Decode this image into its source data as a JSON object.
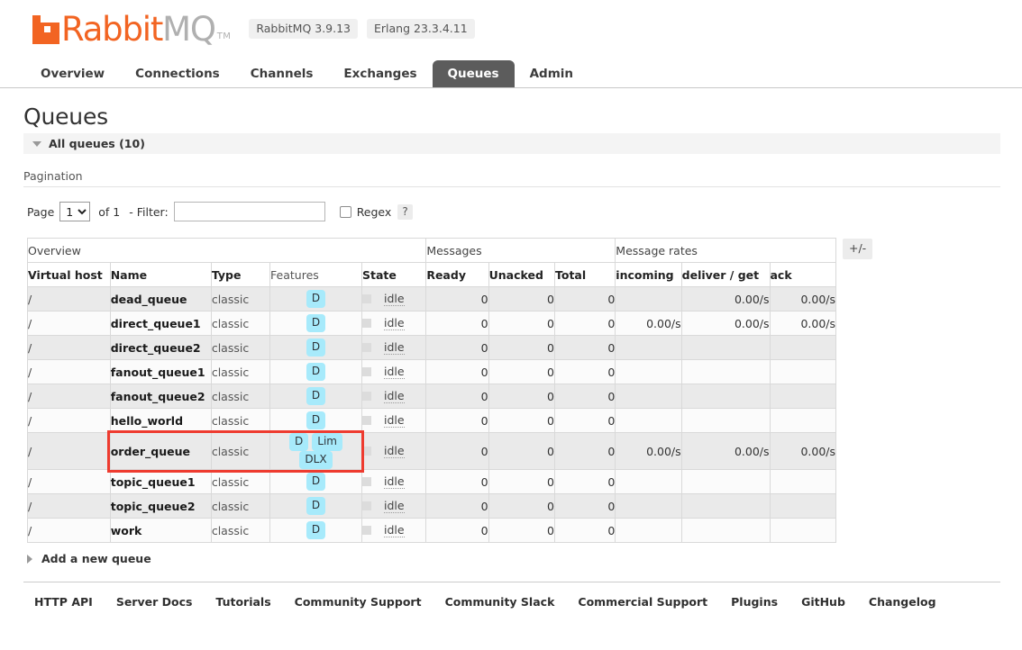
{
  "brand": {
    "name_primary": "Rabbit",
    "name_secondary": "MQ",
    "trademark": "TM",
    "logo_color": "#f26422",
    "versions": [
      {
        "label": "RabbitMQ 3.9.13"
      },
      {
        "label": "Erlang 23.3.4.11"
      }
    ]
  },
  "nav": {
    "tabs": [
      {
        "label": "Overview",
        "active": false
      },
      {
        "label": "Connections",
        "active": false
      },
      {
        "label": "Channels",
        "active": false
      },
      {
        "label": "Exchanges",
        "active": false
      },
      {
        "label": "Queues",
        "active": true
      },
      {
        "label": "Admin",
        "active": false
      }
    ],
    "active_color": "#5c5c5c"
  },
  "page": {
    "title": "Queues",
    "section_header": "All queues (10)"
  },
  "pagination": {
    "label": "Pagination",
    "page_label": "Page",
    "page_value": "1",
    "page_options": [
      "1"
    ],
    "of_label": "of 1",
    "filter_prefix": "- Filter:",
    "filter_value": "",
    "filter_placeholder": "",
    "regex_label": "Regex",
    "regex_checked": false,
    "help_label": "?"
  },
  "table": {
    "group_headers": [
      {
        "label": "Overview",
        "span": 5
      },
      {
        "label": "Messages",
        "span": 3
      },
      {
        "label": "Message rates",
        "span": 3
      }
    ],
    "columns": [
      {
        "label": "Virtual host",
        "sortable": true
      },
      {
        "label": "Name",
        "sortable": true
      },
      {
        "label": "Type",
        "sortable": true
      },
      {
        "label": "Features",
        "sortable": false
      },
      {
        "label": "State",
        "sortable": true
      },
      {
        "label": "Ready",
        "sortable": true
      },
      {
        "label": "Unacked",
        "sortable": true
      },
      {
        "label": "Total",
        "sortable": true
      },
      {
        "label": "incoming",
        "sortable": true
      },
      {
        "label": "deliver / get",
        "sortable": true
      },
      {
        "label": "ack",
        "sortable": true
      }
    ],
    "toggle_columns_label": "+/-",
    "feature_badge_color": "#a7eafb",
    "highlight_color": "#ee3b2f",
    "rows": [
      {
        "vhost": "/",
        "name": "dead_queue",
        "type": "classic",
        "features": [
          "D"
        ],
        "state": "idle",
        "ready": "0",
        "unacked": "0",
        "total": "0",
        "incoming": "",
        "deliver_get": "0.00/s",
        "ack": "0.00/s",
        "highlighted": false
      },
      {
        "vhost": "/",
        "name": "direct_queue1",
        "type": "classic",
        "features": [
          "D"
        ],
        "state": "idle",
        "ready": "0",
        "unacked": "0",
        "total": "0",
        "incoming": "0.00/s",
        "deliver_get": "0.00/s",
        "ack": "0.00/s",
        "highlighted": false
      },
      {
        "vhost": "/",
        "name": "direct_queue2",
        "type": "classic",
        "features": [
          "D"
        ],
        "state": "idle",
        "ready": "0",
        "unacked": "0",
        "total": "0",
        "incoming": "",
        "deliver_get": "",
        "ack": "",
        "highlighted": false
      },
      {
        "vhost": "/",
        "name": "fanout_queue1",
        "type": "classic",
        "features": [
          "D"
        ],
        "state": "idle",
        "ready": "0",
        "unacked": "0",
        "total": "0",
        "incoming": "",
        "deliver_get": "",
        "ack": "",
        "highlighted": false
      },
      {
        "vhost": "/",
        "name": "fanout_queue2",
        "type": "classic",
        "features": [
          "D"
        ],
        "state": "idle",
        "ready": "0",
        "unacked": "0",
        "total": "0",
        "incoming": "",
        "deliver_get": "",
        "ack": "",
        "highlighted": false
      },
      {
        "vhost": "/",
        "name": "hello_world",
        "type": "classic",
        "features": [
          "D"
        ],
        "state": "idle",
        "ready": "0",
        "unacked": "0",
        "total": "0",
        "incoming": "",
        "deliver_get": "",
        "ack": "",
        "highlighted": false
      },
      {
        "vhost": "/",
        "name": "order_queue",
        "type": "classic",
        "features": [
          "D",
          "Lim",
          "DLX"
        ],
        "state": "idle",
        "ready": "0",
        "unacked": "0",
        "total": "0",
        "incoming": "0.00/s",
        "deliver_get": "0.00/s",
        "ack": "0.00/s",
        "highlighted": true
      },
      {
        "vhost": "/",
        "name": "topic_queue1",
        "type": "classic",
        "features": [
          "D"
        ],
        "state": "idle",
        "ready": "0",
        "unacked": "0",
        "total": "0",
        "incoming": "",
        "deliver_get": "",
        "ack": "",
        "highlighted": false
      },
      {
        "vhost": "/",
        "name": "topic_queue2",
        "type": "classic",
        "features": [
          "D"
        ],
        "state": "idle",
        "ready": "0",
        "unacked": "0",
        "total": "0",
        "incoming": "",
        "deliver_get": "",
        "ack": "",
        "highlighted": false
      },
      {
        "vhost": "/",
        "name": "work",
        "type": "classic",
        "features": [
          "D"
        ],
        "state": "idle",
        "ready": "0",
        "unacked": "0",
        "total": "0",
        "incoming": "",
        "deliver_get": "",
        "ack": "",
        "highlighted": false
      }
    ]
  },
  "add_queue": {
    "label": "Add a new queue"
  },
  "footer": {
    "links": [
      {
        "label": "HTTP API"
      },
      {
        "label": "Server Docs"
      },
      {
        "label": "Tutorials"
      },
      {
        "label": "Community Support"
      },
      {
        "label": "Community Slack"
      },
      {
        "label": "Commercial Support"
      },
      {
        "label": "Plugins"
      },
      {
        "label": "GitHub"
      },
      {
        "label": "Changelog"
      }
    ]
  }
}
